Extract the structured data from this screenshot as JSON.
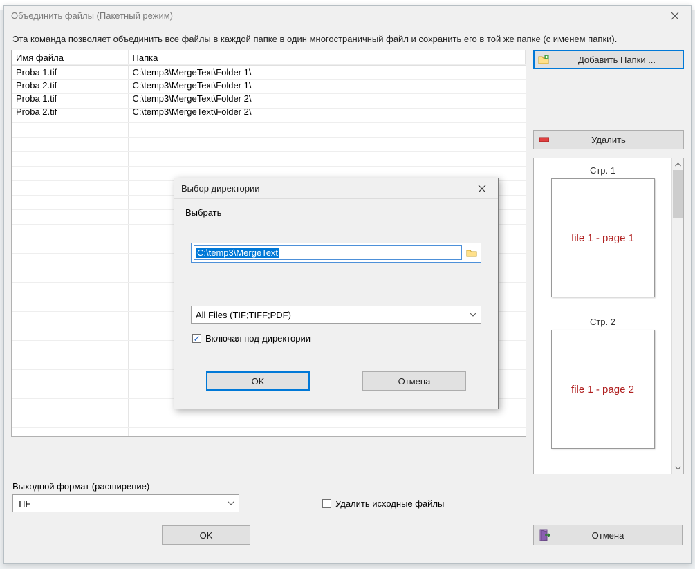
{
  "window": {
    "title": "Объединить файлы (Пакетный режим)",
    "description": "Эта команда позволяет объединить все файлы в каждой папке в один многостраничный файл и сохранить его в той же папке (с именем папки)."
  },
  "table": {
    "col_filename": "Имя файла",
    "col_folder": "Папка",
    "rows": [
      {
        "name": "Proba 1.tif",
        "folder": "C:\\temp3\\MergeText\\Folder 1\\"
      },
      {
        "name": "Proba 2.tif",
        "folder": "C:\\temp3\\MergeText\\Folder 1\\"
      },
      {
        "name": "Proba 1.tif",
        "folder": "C:\\temp3\\MergeText\\Folder 2\\"
      },
      {
        "name": "Proba 2.tif",
        "folder": "C:\\temp3\\MergeText\\Folder 2\\"
      }
    ]
  },
  "side": {
    "add_folders": "Добавить Папки ...",
    "delete": "Удалить"
  },
  "preview": {
    "page_prefix": "Стр.",
    "pages": [
      {
        "n": "1",
        "text": "file 1 - page 1"
      },
      {
        "n": "2",
        "text": "file 1 - page 2"
      }
    ]
  },
  "footer": {
    "output_format_label": "Выходной формат (расширение)",
    "output_format_value": "TIF",
    "delete_source_label": "Удалить исходные файлы",
    "ok": "OK",
    "cancel": "Отмена"
  },
  "subdialog": {
    "title": "Выбор директории",
    "choose_label": "Выбрать",
    "path": "C:\\temp3\\MergeText",
    "filter": "All Files (TIF;TIFF;PDF)",
    "include_sub": "Включая под-директории",
    "ok": "OK",
    "cancel": "Отмена"
  }
}
